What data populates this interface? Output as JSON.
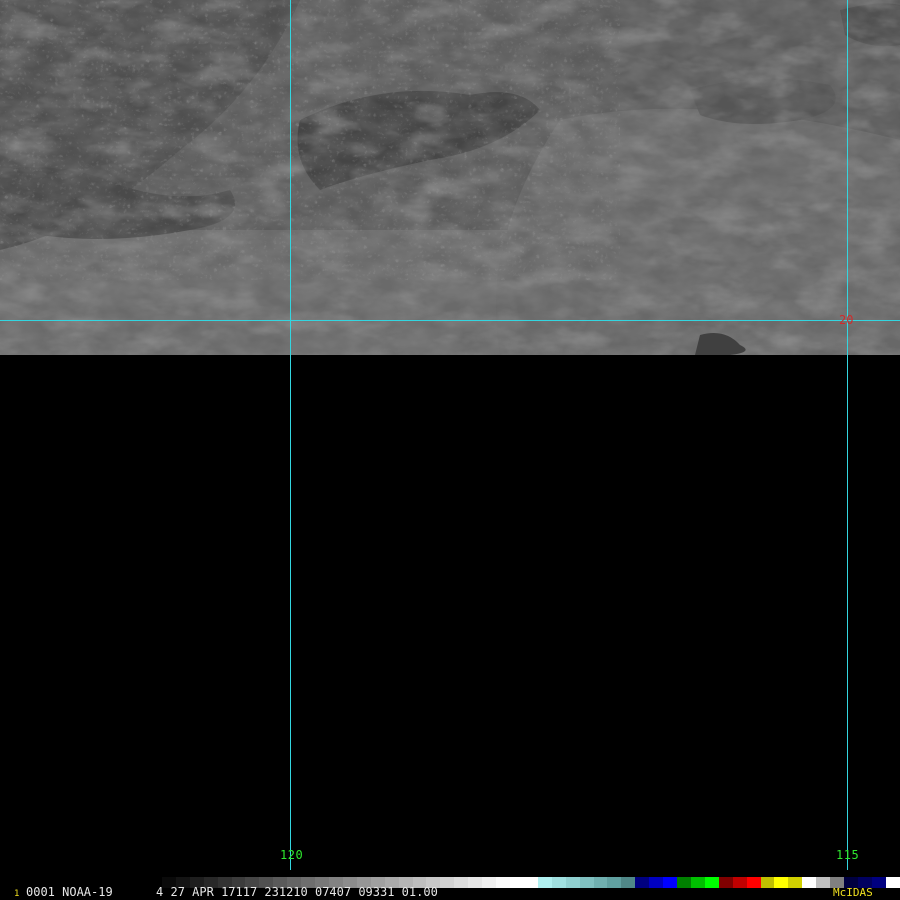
{
  "frame_number": "1",
  "status_line": "0001 NOAA-19      4 27 APR 17117 231210 07407 09331 01.00",
  "brand": "McIDAS",
  "grid": {
    "line_color": "#33d6e0",
    "longitude_labels": [
      {
        "name": "lon-120",
        "text": "120",
        "color": "#2ee82e"
      },
      {
        "name": "lon-115",
        "text": "115",
        "color": "#2ee82e"
      }
    ],
    "latitude_labels": [
      {
        "name": "lat-20",
        "text": "20",
        "color": "#d02a2a"
      }
    ]
  },
  "colorbar": [
    "#000000",
    "#0a0a0a",
    "#141414",
    "#1e1e1e",
    "#282828",
    "#323232",
    "#3c3c3c",
    "#464646",
    "#505050",
    "#5a5a5a",
    "#646464",
    "#6e6e6e",
    "#787878",
    "#828282",
    "#8c8c8c",
    "#969696",
    "#a0a0a0",
    "#aaaaaa",
    "#b4b4b4",
    "#bebebe",
    "#c8c8c8",
    "#d2d2d2",
    "#dcdcdc",
    "#e6e6e6",
    "#f0f0f0",
    "#fafafa",
    "#ffffff",
    "#ffffff",
    "#b0f0f0",
    "#a0e0e0",
    "#90d0d0",
    "#80c0c0",
    "#70b0b0",
    "#60a0a0",
    "#508888",
    "#000080",
    "#0000c0",
    "#0000ff",
    "#008000",
    "#00c000",
    "#00ff00",
    "#800000",
    "#c00000",
    "#ff0000",
    "#c0c000",
    "#ffff00",
    "#d0d000",
    "#ffffff",
    "#c0c0c0",
    "#808080",
    "#000040",
    "#000060",
    "#000080",
    "#ffffff"
  ]
}
